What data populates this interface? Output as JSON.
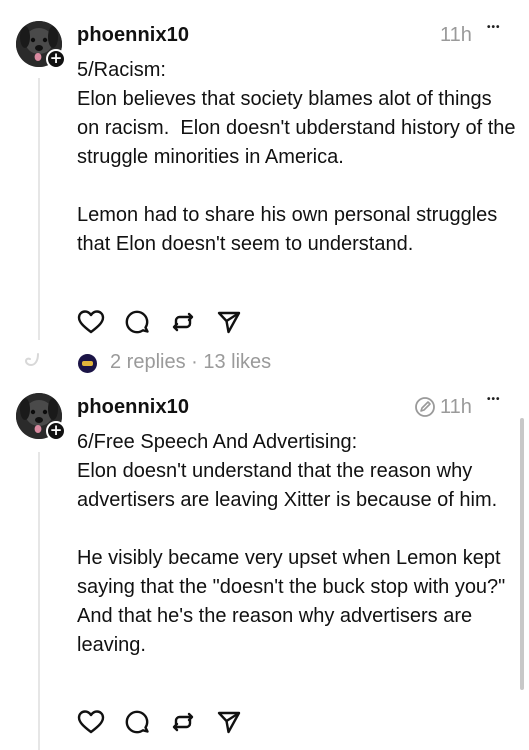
{
  "posts": [
    {
      "username": "phoennix10",
      "time": "11h",
      "more": "•••",
      "paragraphs": [
        "5/Racism:\nElon believes that society blames alot of things on racism.  Elon doesn't ubderstand history of the struggle minorities in America.",
        "Lemon had to share his own personal struggles that Elon doesn't seem to understand."
      ],
      "avatar_icon": "dog-avatar",
      "badge_icon": "plus-icon"
    },
    {
      "username": "phoennix10",
      "time": "11h",
      "more": "•••",
      "edited_icon": "edited-icon",
      "paragraphs": [
        "6/Free Speech And Advertising:\nElon doesn't understand that the reason why advertisers are leaving Xitter is because of him.",
        "He visibly became very upset when Lemon kept saying that the \"doesn't the buck stop with you?\" And that he's the reason why advertisers are leaving."
      ],
      "avatar_icon": "dog-avatar",
      "badge_icon": "plus-icon"
    }
  ],
  "thread_summary": {
    "text": "2 replies · 13 likes"
  },
  "action_icons": [
    "heart-icon",
    "comment-icon",
    "repost-icon",
    "send-icon"
  ],
  "colors": {
    "text": "#111111",
    "muted": "#9a9a9a",
    "thread_line": "#e6e6e6",
    "mini_avatar_bg": "#1b1446",
    "mini_avatar_accent": "#e2b53b"
  }
}
